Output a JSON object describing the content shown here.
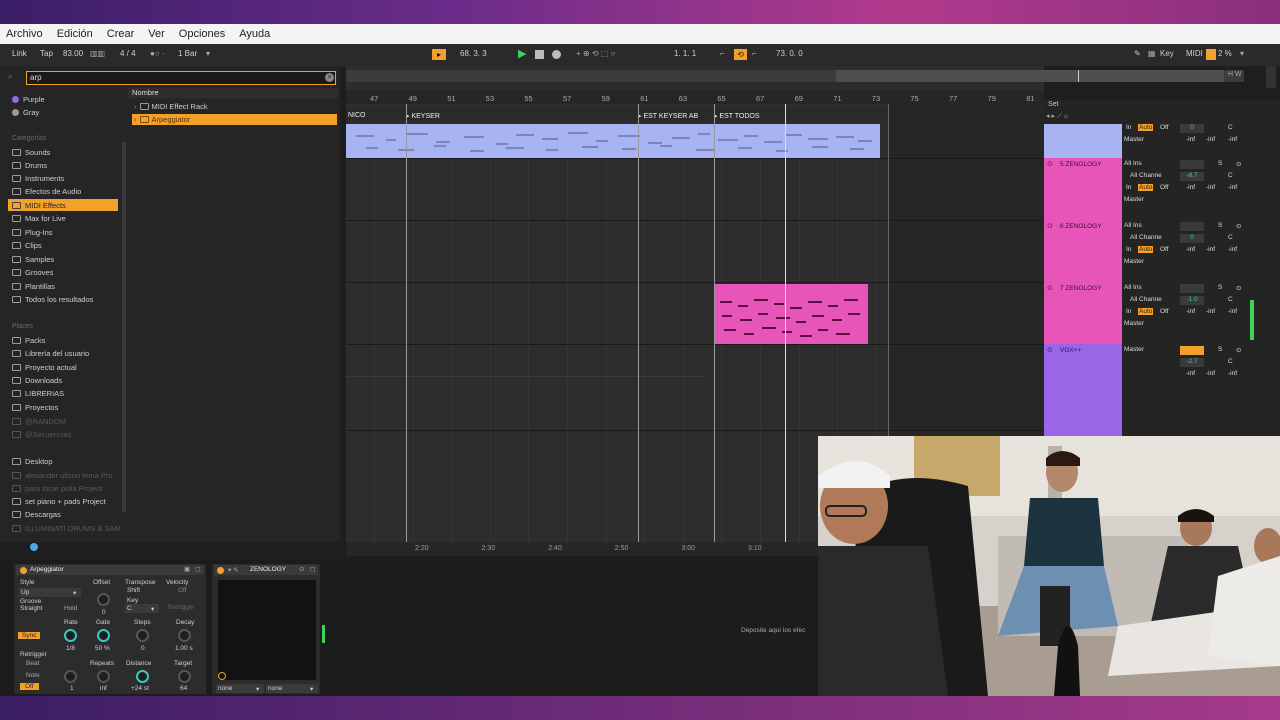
{
  "menu": [
    "Archivo",
    "Edición",
    "Crear",
    "Ver",
    "Opciones",
    "Ayuda"
  ],
  "transport": {
    "link": "Link",
    "tap": "Tap",
    "tempo": "83.00",
    "signature": "4 / 4",
    "quantize": "1 Bar",
    "position": "68.  3.  3",
    "loop_start": "1.  1.  1",
    "loop_length": "73.  0.  0",
    "key_label": "Key",
    "midi_label": "MIDI",
    "cpu": "2 %"
  },
  "browser": {
    "search_value": "arp",
    "colors": [
      "Purple",
      "Gray"
    ],
    "categories_label": "Categorías",
    "categories": [
      "Sounds",
      "Drums",
      "Instruments",
      "Efectos de Audio",
      "MIDI Effects",
      "Max for Live",
      "Plug-Ins",
      "Clips",
      "Samples",
      "Grooves",
      "Plantillas",
      "Todos los resultados"
    ],
    "selected_category": "MIDI Effects",
    "places_label": "Places",
    "places": [
      "Packs",
      "Librería del usuario",
      "Proyecto actual",
      "Downloads",
      "LIBRERIAS",
      "Proyectos",
      "@RANDOM",
      "@Secuencias",
      "Desktop",
      "alexander ultimo tema Pro",
      "para tocar piola Project",
      "set piano + pads Project",
      "Descargas",
      "ILLUMINATI DRUMS & SAM"
    ],
    "column_header": "Nombre",
    "results": [
      "MIDI Effect Rack",
      "Arpeggiator"
    ]
  },
  "arrangement": {
    "bars": [
      "47",
      "49",
      "51",
      "53",
      "55",
      "57",
      "59",
      "61",
      "63",
      "65",
      "67",
      "69",
      "71",
      "73",
      "75",
      "77",
      "79",
      "81"
    ],
    "locators": [
      "NICO",
      "KEYSER",
      "EST KEYSER AB",
      "EST TODOS"
    ],
    "times": [
      "2:20",
      "2:30",
      "2:40",
      "2:50",
      "3:00",
      "3:10"
    ],
    "set_label": "Set"
  },
  "mixer": {
    "tracks": [
      {
        "name": "",
        "color": "#a8b4f2"
      },
      {
        "name": "5 ZENOLOGY",
        "color": "#e855b8",
        "vol": "-8.7"
      },
      {
        "name": "6 ZENOLOGY",
        "color": "#e855b8",
        "vol": "0"
      },
      {
        "name": "7 ZENOLOGY",
        "color": "#e855b8",
        "vol": "-1.0"
      },
      {
        "name": "VOX++",
        "color": "#9a66e8",
        "vol": "-2.7"
      }
    ],
    "input": "All Ins",
    "channel": "All Channe",
    "monitor_in": "In",
    "monitor_auto": "Auto",
    "monitor_off": "Off",
    "output": "Master",
    "inf": "-inf",
    "pan": "C",
    "solo": "S"
  },
  "device": {
    "arp_title": "Arpeggiator",
    "zenology_title": "ZENOLOGY",
    "style_label": "Style",
    "style_value": "Up",
    "groove_label": "Groove",
    "groove_value": "Straight",
    "hold": "Hold",
    "offset_label": "Offset",
    "offset_value": "0",
    "transpose_label": "Transpose",
    "transpose_value": "Shift",
    "key_label": "Key",
    "key_value": "C",
    "velocity_label": "Velocity",
    "velocity_value": "Off",
    "retrigger_btn": "Retrigger",
    "sync": "Sync",
    "rate_label": "Rate",
    "rate_value": "1/8",
    "gate_label": "Gate",
    "gate_value": "50 %",
    "steps_label": "Steps",
    "steps_value": "0",
    "decay_label": "Decay",
    "decay_value": "1.00 s",
    "retrig_label": "Retrigger",
    "beat": "Beat",
    "note": "Note",
    "off": "Off",
    "retrig_value": "1",
    "repeats_label": "Repeats",
    "repeats_value": "inf",
    "distance_label": "Distance",
    "distance_value": "+24 st",
    "target_label": "Target",
    "target_value": "64",
    "dropdown_a": "none",
    "dropdown_b": "none",
    "drop_hint": "Deposite aquí los efec"
  }
}
